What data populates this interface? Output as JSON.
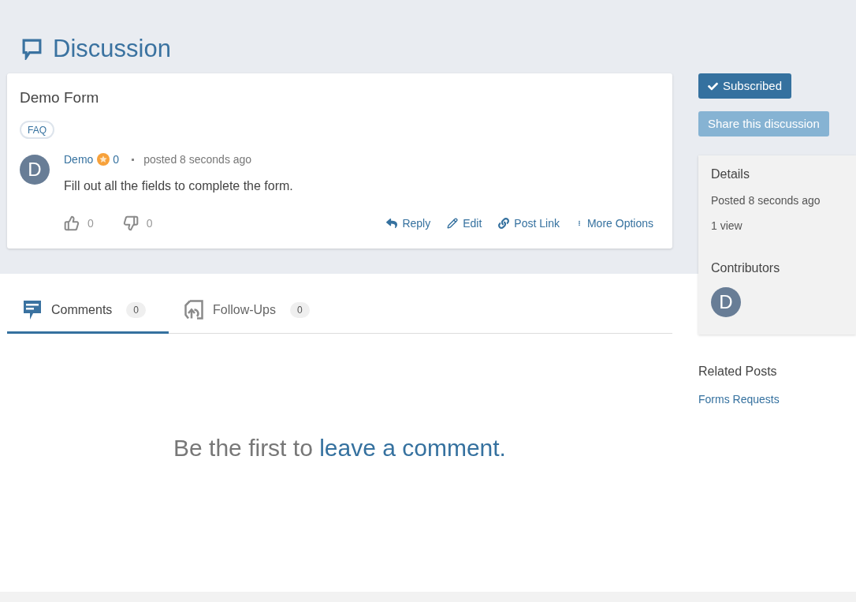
{
  "header": {
    "title": "Discussion"
  },
  "post": {
    "title": "Demo Form",
    "tags": [
      "FAQ"
    ],
    "author": {
      "initial": "D",
      "name": "Demo",
      "points": "0"
    },
    "time": "posted 8 seconds ago",
    "body": "Fill out all the fields to complete the form.",
    "votes": [
      {
        "kind": "up",
        "count": "0"
      },
      {
        "kind": "down",
        "count": "0"
      }
    ],
    "actions": [
      {
        "kind": "reply",
        "label": "Reply"
      },
      {
        "kind": "edit",
        "label": "Edit"
      },
      {
        "kind": "link",
        "label": "Post Link"
      },
      {
        "kind": "more",
        "label": "More Options"
      }
    ]
  },
  "tabs": [
    {
      "kind": "comments",
      "label": "Comments",
      "count": "0",
      "selected": true
    },
    {
      "kind": "follow_ups",
      "label": "Follow-Ups",
      "count": "0",
      "selected": false
    }
  ],
  "empty_state": {
    "text": "Be the first to",
    "link": "leave a comment."
  },
  "sidebar": {
    "subscribe_button": {
      "label": "Subscribed",
      "on": true
    },
    "share_button": {
      "label": "Share this discussion"
    },
    "details": {
      "title": "Details",
      "posted": "Posted 8 seconds ago",
      "views": "1 view"
    },
    "contributors": {
      "title": "Contributors",
      "people": [
        {
          "initial": "D"
        }
      ]
    },
    "related_posts": {
      "title": "Related Posts",
      "links": [
        "Forms Requests"
      ]
    }
  }
}
